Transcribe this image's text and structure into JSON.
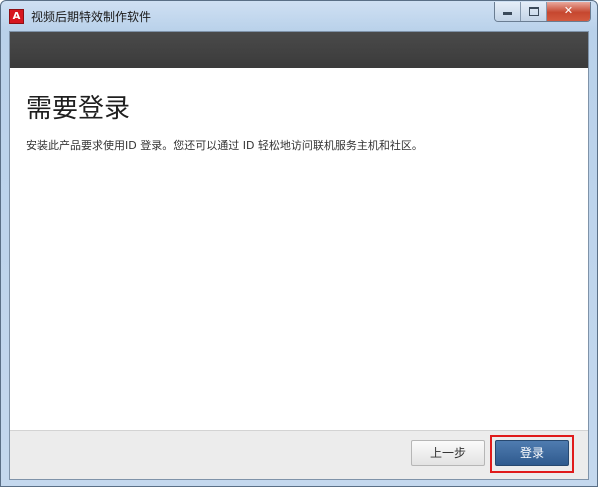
{
  "window": {
    "title": "视频后期特效制作软件",
    "app_icon_glyph": "A",
    "app_icon_name": "adobe-logo-icon",
    "caption": {
      "close_glyph": "✕"
    }
  },
  "main": {
    "heading": "需要登录",
    "description": "安装此产品要求使用ID 登录。您还可以通过 ID 轻松地访问联机服务主机和社区。"
  },
  "footer": {
    "back_label": "上一步",
    "login_label": "登录"
  },
  "colors": {
    "header_band": "#3b3b3b",
    "login_button": "#2f5a8e",
    "highlight": "#e01b1b"
  }
}
